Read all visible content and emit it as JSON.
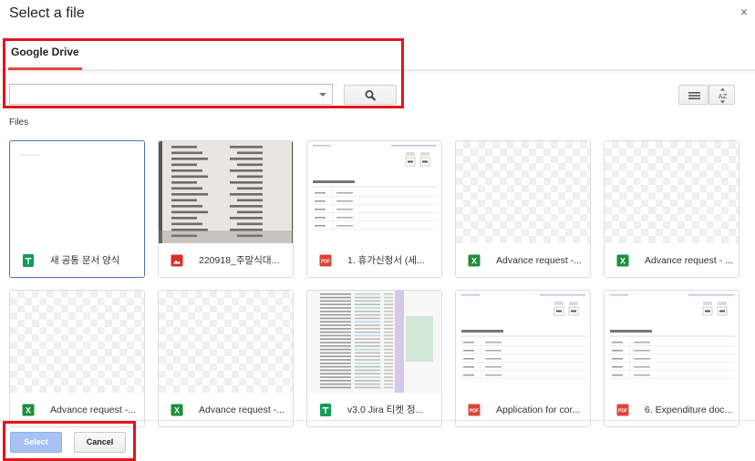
{
  "dialog": {
    "title": "Select a file",
    "close_glyph": "×"
  },
  "tabs": [
    {
      "label": "Google Drive",
      "active": true
    }
  ],
  "search": {
    "value": "",
    "placeholder": ""
  },
  "files_label": "Files",
  "files": [
    {
      "name": "새 공통 문서 양식",
      "type": "sheets",
      "icon": "google-sheets-icon",
      "selected": true,
      "thumb": "blank"
    },
    {
      "name": "220918_주말식대...",
      "type": "image",
      "icon": "image-file-icon",
      "selected": false,
      "thumb": "receipt"
    },
    {
      "name": "1. 휴가신청서 (세...",
      "type": "pdf",
      "icon": "pdf-file-icon",
      "selected": false,
      "thumb": "document"
    },
    {
      "name": "Advance request -...",
      "type": "excel",
      "icon": "excel-file-icon",
      "selected": false,
      "thumb": "checker"
    },
    {
      "name": "Advance request - ...",
      "type": "excel",
      "icon": "excel-file-icon",
      "selected": false,
      "thumb": "checker"
    },
    {
      "name": "Advance request -...",
      "type": "excel",
      "icon": "excel-file-icon",
      "selected": false,
      "thumb": "checker"
    },
    {
      "name": "Advance request -...",
      "type": "excel",
      "icon": "excel-file-icon",
      "selected": false,
      "thumb": "checker"
    },
    {
      "name": "v3.0 Jira 티켓 정...",
      "type": "sheets",
      "icon": "google-sheets-icon",
      "selected": false,
      "thumb": "spreadsheet"
    },
    {
      "name": "Application for cor...",
      "type": "pdf",
      "icon": "pdf-file-icon",
      "selected": false,
      "thumb": "document"
    },
    {
      "name": "6. Expenditure doc...",
      "type": "pdf",
      "icon": "pdf-file-icon",
      "selected": false,
      "thumb": "document"
    }
  ],
  "footer": {
    "select_label": "Select",
    "cancel_label": "Cancel"
  },
  "colors": {
    "sheets": "#0f9d58",
    "excel": "#1e8e3e",
    "pdf": "#db4437",
    "image": "#d93025",
    "tab_underline": "#dd4b39",
    "select_button": "#a6c1f2",
    "highlight": "#e8121b"
  }
}
